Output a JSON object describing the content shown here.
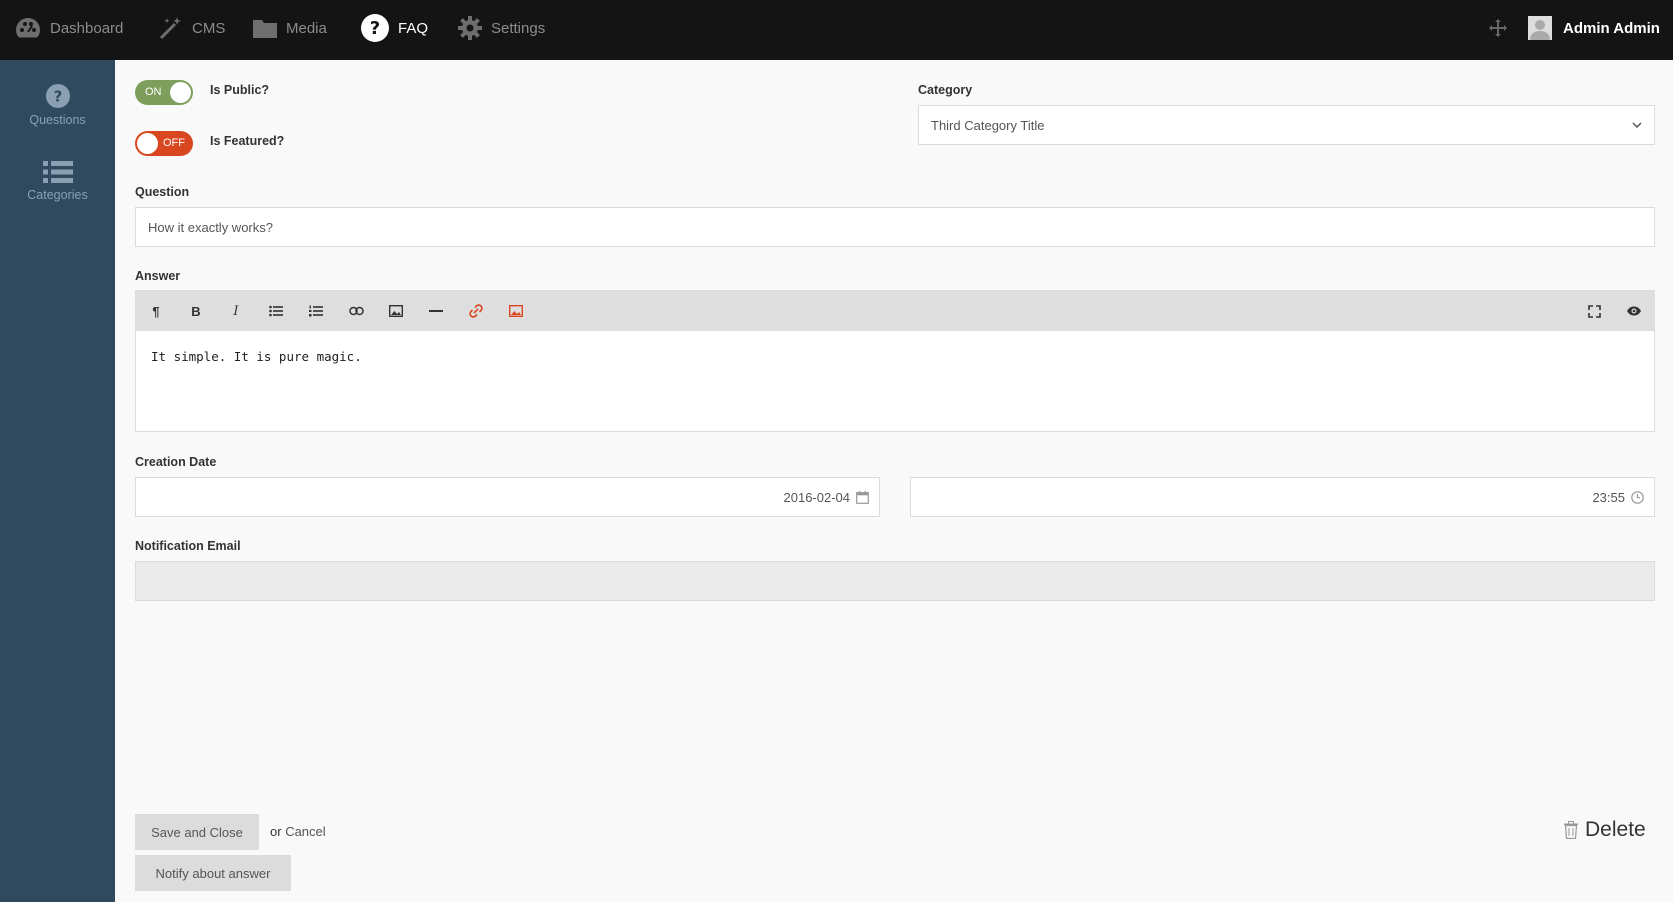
{
  "nav": {
    "items": [
      {
        "label": "Dashboard",
        "icon": "dashboard-icon"
      },
      {
        "label": "CMS",
        "icon": "magic-wand-icon"
      },
      {
        "label": "Media",
        "icon": "folder-icon"
      },
      {
        "label": "FAQ",
        "icon": "question-circle-icon",
        "active": true
      },
      {
        "label": "Settings",
        "icon": "gear-icon"
      }
    ],
    "user_name": "Admin Admin"
  },
  "sidebar": {
    "items": [
      {
        "label": "Questions",
        "icon": "question-circle-icon"
      },
      {
        "label": "Categories",
        "icon": "list-icon"
      }
    ]
  },
  "form": {
    "is_public": {
      "label": "Is Public?",
      "state": "ON"
    },
    "is_featured": {
      "label": "Is Featured?",
      "state": "OFF"
    },
    "category": {
      "label": "Category",
      "value": "Third Category Title"
    },
    "question": {
      "label": "Question",
      "value": "How it exactly works?"
    },
    "answer": {
      "label": "Answer",
      "value": "It simple. It is pure magic."
    },
    "creation_date": {
      "label": "Creation Date",
      "date": "2016-02-04",
      "time": "23:55"
    },
    "notification_email": {
      "label": "Notification Email",
      "value": ""
    }
  },
  "toolbar": {
    "paragraph": "¶",
    "bold": "B",
    "italic": "I"
  },
  "actions": {
    "save_close": "Save and Close",
    "or": "or",
    "cancel": "Cancel",
    "delete": "Delete",
    "notify": "Notify about answer"
  },
  "colors": {
    "toggle_on": "#7d9f5b",
    "toggle_off": "#d8471f",
    "sidebar_bg": "#2f4a5f",
    "topbar_bg": "#141414"
  }
}
